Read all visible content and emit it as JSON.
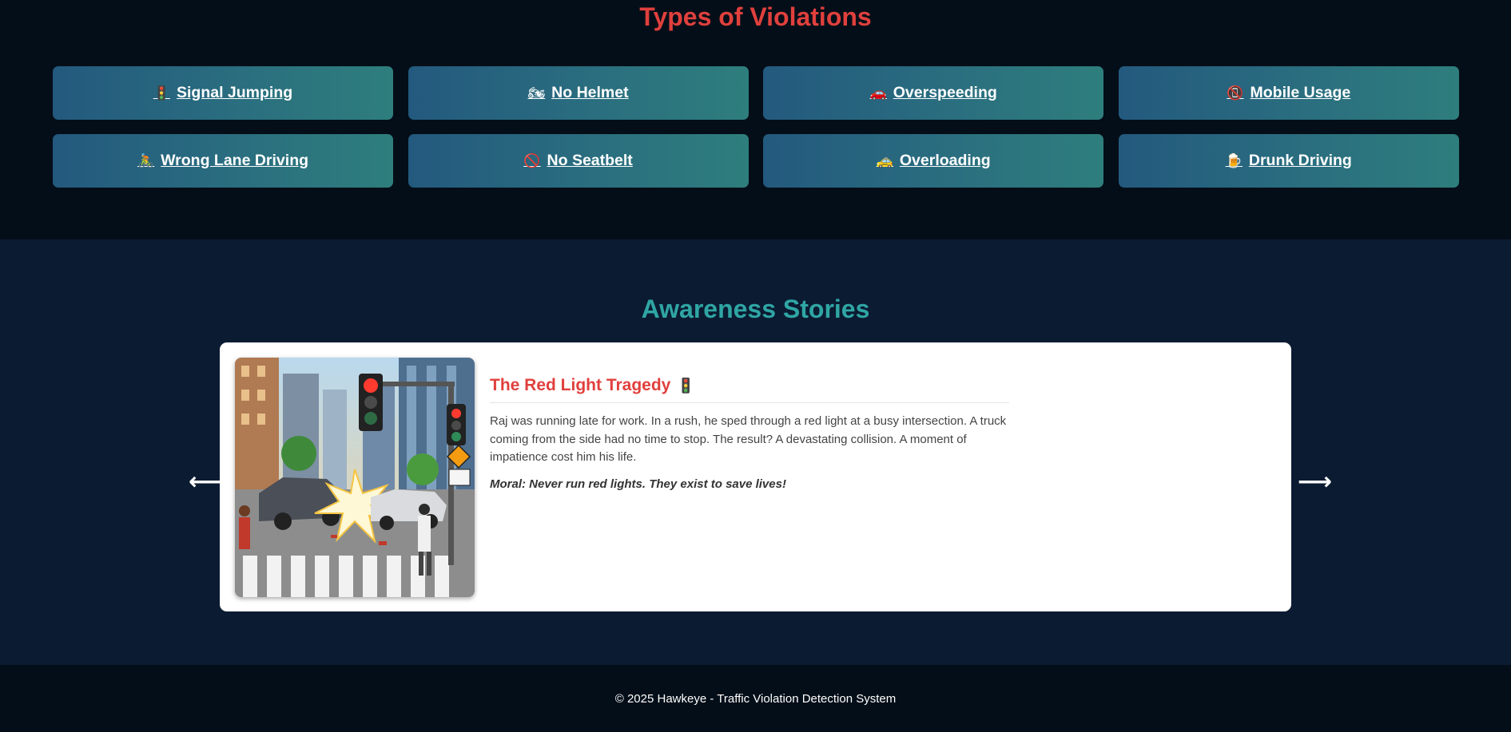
{
  "violations": {
    "title": "Types of Violations",
    "items": [
      {
        "icon": "🚦",
        "icon_name": "traffic-light-icon",
        "label": "Signal Jumping"
      },
      {
        "icon": "🏍",
        "icon_name": "motorcycle-icon",
        "label": "No Helmet"
      },
      {
        "icon": "🚗",
        "icon_name": "car-icon",
        "label": "Overspeeding"
      },
      {
        "icon": "📵",
        "icon_name": "no-mobile-icon",
        "label": "Mobile Usage"
      },
      {
        "icon": "🚴",
        "icon_name": "cyclist-icon",
        "label": "Wrong Lane Driving"
      },
      {
        "icon": "🚫",
        "icon_name": "prohibited-icon",
        "label": "No Seatbelt"
      },
      {
        "icon": "🚕",
        "icon_name": "taxi-icon",
        "label": "Overloading"
      },
      {
        "icon": "🍺",
        "icon_name": "beer-icon",
        "label": "Drunk Driving"
      }
    ]
  },
  "stories": {
    "title": "Awareness Stories",
    "prev_arrow": "⟵",
    "next_arrow": "⟶",
    "current": {
      "title": "The Red Light Tragedy",
      "title_icon": "🚦",
      "body": "Raj was running late for work. In a rush, he sped through a red light at a busy intersection. A truck coming from the side had no time to stop. The result? A devastating collision. A moment of impatience cost him his life.",
      "moral": "Moral: Never run red lights. They exist to save lives!"
    }
  },
  "footer": {
    "text": "© 2025 Hawkeye - Traffic Violation Detection System"
  },
  "colors": {
    "violations_title": "#e0403d",
    "stories_title": "#2fa6a4",
    "card_gradient_start": "#23597e",
    "card_gradient_end": "#2e7e7d",
    "page_bg": "#040e18",
    "stories_bg": "#0b1b32"
  }
}
